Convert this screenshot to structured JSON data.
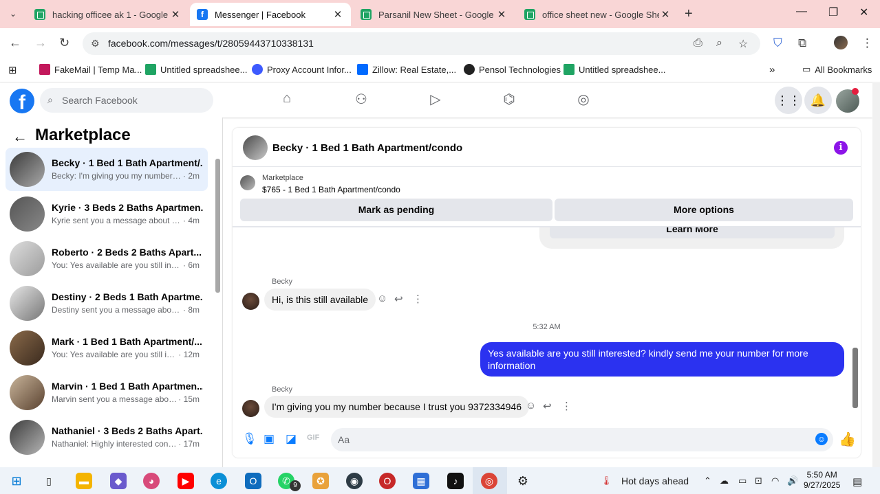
{
  "browser": {
    "tabs": [
      {
        "title": "hacking officee ak 1 - Google Sh",
        "favicon": "sheets-icon"
      },
      {
        "title": "Messenger | Facebook",
        "favicon": "facebook-icon",
        "active": true
      },
      {
        "title": "Parsanil New Sheet - Google She",
        "favicon": "sheets-icon"
      },
      {
        "title": "office sheet new - Google Shee",
        "favicon": "sheets-icon"
      }
    ],
    "url": "facebook.com/messages/t/28059443710338131",
    "bookmarks": [
      {
        "label": "FakeMail | Temp Ma..."
      },
      {
        "label": "Untitled spreadshee..."
      },
      {
        "label": "Proxy Account Infor..."
      },
      {
        "label": "Zillow: Real Estate,..."
      },
      {
        "label": "Pensol Technologies"
      },
      {
        "label": "Untitled spreadshee..."
      }
    ],
    "all_bookmarks": "All Bookmarks"
  },
  "facebook": {
    "search_placeholder": "Search Facebook"
  },
  "sidebar": {
    "title": "Marketplace",
    "conversations": [
      {
        "name": "Becky · 1 Bed 1 Bath Apartment/...",
        "preview": "Becky: I'm giving you my number ...",
        "time": "· 2m",
        "active": true
      },
      {
        "name": "Kyrie · 3 Beds 2 Baths Apartmen...",
        "preview": "Kyrie sent you a message about yo...",
        "time": "· 4m"
      },
      {
        "name": "Roberto · 2 Beds 2 Baths Apart...",
        "preview": "You: Yes available are you still inter...",
        "time": "· 6m"
      },
      {
        "name": "Destiny · 2 Beds 1 Bath Apartme...",
        "preview": "Destiny sent you a message about...",
        "time": "· 8m"
      },
      {
        "name": "Mark · 1 Bed 1 Bath Apartment/...",
        "preview": "You: Yes available are you still int...",
        "time": "· 12m"
      },
      {
        "name": "Marvin · 1 Bed 1 Bath Apartmen...",
        "preview": "Marvin sent you a message abou...",
        "time": "· 15m"
      },
      {
        "name": "Nathaniel · 3 Beds 2 Baths Apart...",
        "preview": "Nathaniel: Highly interested cont...",
        "time": "· 17m"
      }
    ]
  },
  "chat": {
    "title": "Becky · 1 Bed 1 Bath Apartment/condo",
    "listing_category": "Marketplace",
    "listing_detail": "$765 - 1 Bed 1 Bath Apartment/condo",
    "mark_pending": "Mark as pending",
    "more_options": "More options",
    "learn_more": "Learn More",
    "messages": [
      {
        "sender": "Becky",
        "text": "Hi, is this still available"
      },
      {
        "timestamp": "5:32 AM"
      },
      {
        "text": "Yes available are you still interested? kindly send me your number for more information"
      },
      {
        "sender": "Becky",
        "text": "I'm giving you my number because I trust you 9372334946"
      }
    ],
    "composer_placeholder": "Aa"
  },
  "taskbar": {
    "weather": "Hot days ahead",
    "time": "5:50 AM",
    "date": "9/27/2025",
    "whatsapp_badge": "9"
  }
}
